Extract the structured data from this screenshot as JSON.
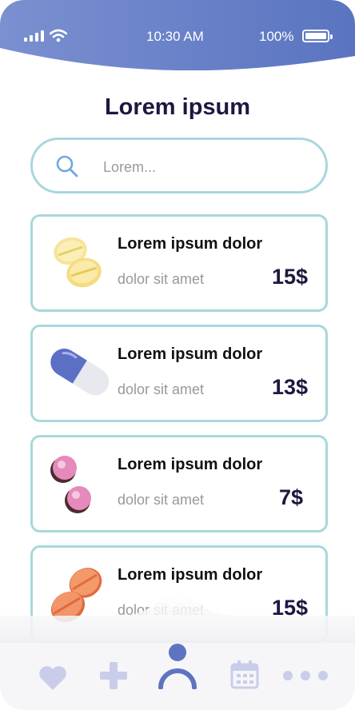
{
  "status": {
    "time": "10:30 AM",
    "battery": "100%"
  },
  "header": {
    "title": "Lorem ipsum"
  },
  "search": {
    "placeholder": "Lorem..."
  },
  "products": [
    {
      "name": "Lorem ipsum dolor",
      "subtitle": "dolor sit amet",
      "price": "15$",
      "icon": "yellow-pills-icon"
    },
    {
      "name": "Lorem ipsum dolor",
      "subtitle": "dolor sit amet",
      "price": "13$",
      "icon": "capsule-icon"
    },
    {
      "name": "Lorem ipsum dolor",
      "subtitle": "dolor sit amet",
      "price": "7$",
      "icon": "pink-pills-icon"
    },
    {
      "name": "Lorem ipsum dolor",
      "subtitle": "dolor sit amet",
      "price": "15$",
      "icon": "orange-pills-icon"
    }
  ],
  "nav": [
    "heart-icon",
    "plus-icon",
    "profile-icon",
    "calendar-icon",
    "more-icon"
  ],
  "colors": {
    "header": "#6a84c8",
    "border": "#a8d8dc",
    "title": "#1c1840",
    "nav": "#c9cdea",
    "nav_active": "#5f74c0"
  }
}
